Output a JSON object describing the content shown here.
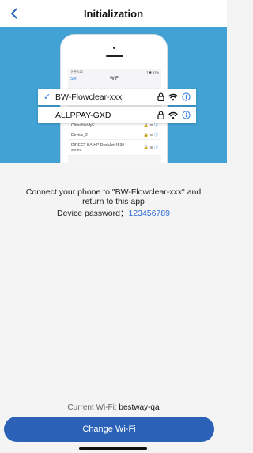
{
  "nav": {
    "title": "Initialization"
  },
  "illustration": {
    "status_time": "下午2:20",
    "status_right": "7 ✱ 37%",
    "settings_back": "Set",
    "wifi_title": "WiFi",
    "networks": [
      {
        "name": "BW-Flowclear-xxx",
        "selected": true
      },
      {
        "name": "ALLPPAY-GXD",
        "selected": false
      }
    ],
    "mini_networks": [
      "ChinaNet-fyE",
      "Device_2",
      "DIRECT-BA-HP DeskJet 4530 series"
    ]
  },
  "instruction": "Connect your phone to \"BW-Flowclear-xxx\" and return to this app",
  "password": {
    "label": "Device password：",
    "value": "123456789"
  },
  "current_wifi": {
    "label": "Current Wi-Fi: ",
    "value": "bestway-qa"
  },
  "button": {
    "label": "Change Wi-Fi"
  },
  "colors": {
    "accent": "#2b62b8",
    "hero": "#42a2d4",
    "link": "#2b6bd9"
  },
  "icons": [
    "back-arrow-icon",
    "checkmark-icon",
    "lock-icon",
    "wifi-icon",
    "info-icon"
  ]
}
